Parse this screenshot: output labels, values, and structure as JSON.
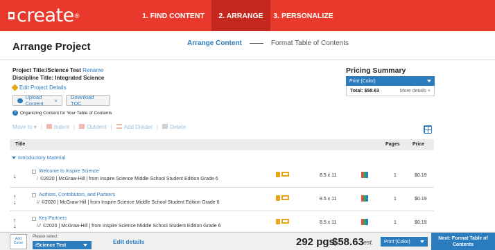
{
  "nav": {
    "logo": "create",
    "logo_mark": "®",
    "tabs": [
      "1. FIND CONTENT",
      "2. ARRANGE",
      "3. PERSONALIZE"
    ]
  },
  "header": {
    "title": "Arrange Project",
    "step_active": "Arrange Content",
    "step_next": "Format Table of Contents"
  },
  "project": {
    "title_label": "Project Title:",
    "title_value": "iScience Test",
    "rename": "Rename",
    "discipline_label": "Discipline Title:",
    "discipline_value": "Integrated Science",
    "edit_details": "Edit Project Details",
    "upload": "Upload Content",
    "download_toc": "Download TOC",
    "organizing": "Organizing Content for Your Table of Contents"
  },
  "toolbar": {
    "move_to": "Move to",
    "indent": "Indent",
    "outdent": "Outdent",
    "add_divider": "Add Divider",
    "delete": "Delete"
  },
  "pricing": {
    "title": "Pricing Summary",
    "selected": "Print (Color)",
    "total": "Total: $58.63",
    "more": "More details +"
  },
  "table": {
    "headers": {
      "title": "Title",
      "pages": "Pages",
      "price": "Price"
    },
    "section": "Introductory Material",
    "rows": [
      {
        "title": "Welcome to Inspire Science",
        "num": "I",
        "sub": "©2020 | McGraw-Hill | from Inspire Science Middle School Student Edition Grade 6",
        "size": "8.5 x 11",
        "pages": "1",
        "price": "$0.19"
      },
      {
        "title": "Authors, Contributors, and Partners",
        "num": "II",
        "sub": "©2020 | McGraw-Hill | from Inspire Science Middle School Student Edition Grade 6",
        "size": "8.5 x 11",
        "pages": "1",
        "price": "$0.19"
      },
      {
        "title": "Key Partners",
        "num": "III",
        "sub": "©2020 | McGraw-Hill | from Inspire Science Middle School Student Edition Grade 6",
        "size": "8.5 x 11",
        "pages": "1",
        "price": "$0.19"
      }
    ]
  },
  "footer": {
    "add_cover": "Add Cover",
    "please_select": "Please select",
    "project_select": "iScience Test",
    "edit_details": "Edit details",
    "pages": "292 pgs",
    "total": "$58.63",
    "est": "est.",
    "format": "Print (Color)",
    "next": "Next: Format Table of Contents"
  },
  "colors": {
    "brand": "#e8392c",
    "accent": "#2b7bbf"
  }
}
